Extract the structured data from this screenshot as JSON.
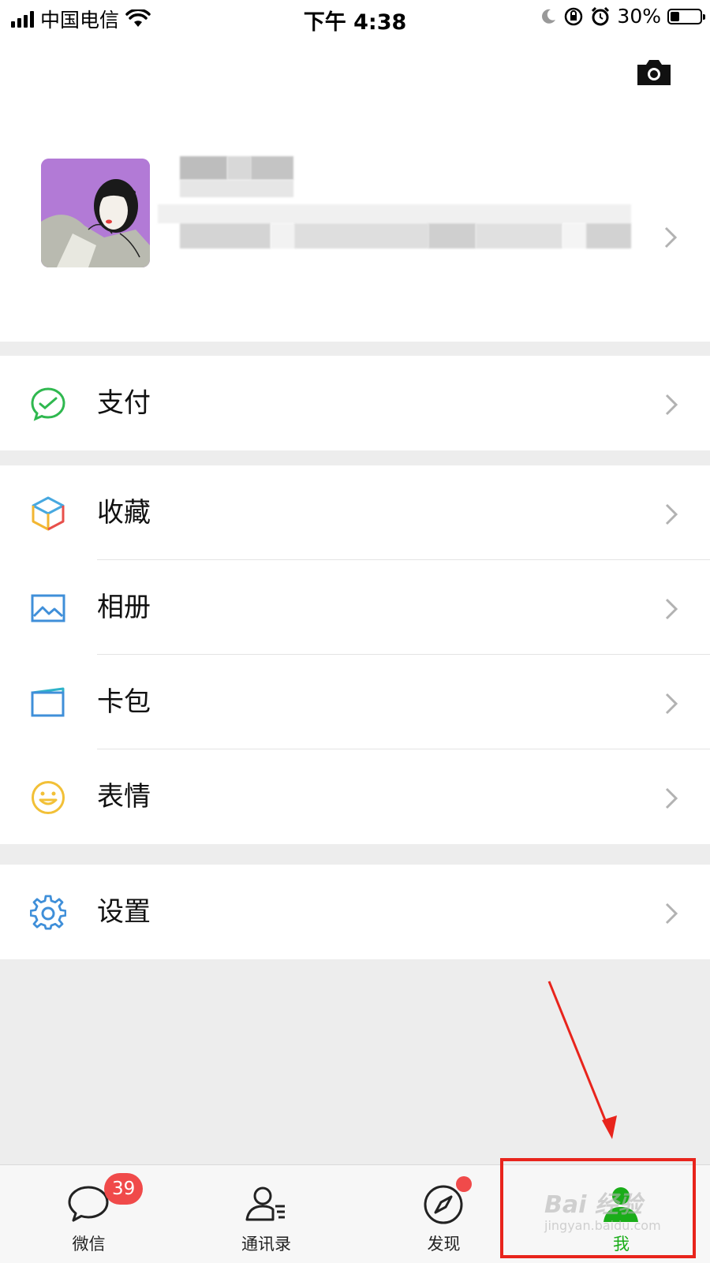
{
  "status_bar": {
    "carrier": "中国电信",
    "time": "下午 4:38",
    "battery": "30%",
    "battery_level": 0.3
  },
  "menu": {
    "pay": "支付",
    "favorites": "收藏",
    "album": "相册",
    "cards": "卡包",
    "stickers": "表情",
    "settings": "设置"
  },
  "tabs": [
    {
      "label": "微信",
      "badge": "39"
    },
    {
      "label": "通讯录"
    },
    {
      "label": "发现",
      "dot": true
    },
    {
      "label": "我",
      "active": true
    }
  ],
  "watermark": {
    "text": "Bai 经验",
    "sub": "jingyan.baidu.com"
  },
  "colors": {
    "accent": "#1aad19",
    "badge": "#f04a4a",
    "annotation": "#e8241c"
  }
}
